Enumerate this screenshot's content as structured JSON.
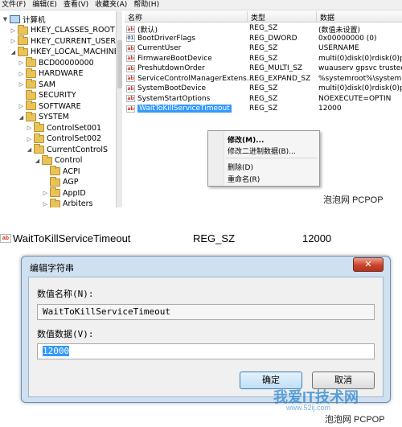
{
  "regedit": {
    "menu": [
      "文件(F)",
      "编辑(E)",
      "查看(V)",
      "收藏夹(A)",
      "帮助(H)"
    ],
    "tree": [
      {
        "label": "计算机",
        "indent": 0,
        "icon": "computer-icon",
        "toggle": "▼"
      },
      {
        "label": "HKEY_CLASSES_ROOT",
        "indent": 1,
        "icon": "folder-icon",
        "toggle": "▷"
      },
      {
        "label": "HKEY_CURRENT_USER",
        "indent": 1,
        "icon": "folder-icon",
        "toggle": "▷"
      },
      {
        "label": "HKEY_LOCAL_MACHINE",
        "indent": 1,
        "icon": "folder-icon",
        "toggle": "◢"
      },
      {
        "label": "BCD00000000",
        "indent": 2,
        "icon": "folder-icon",
        "toggle": "▷"
      },
      {
        "label": "HARDWARE",
        "indent": 2,
        "icon": "folder-icon",
        "toggle": "▷"
      },
      {
        "label": "SAM",
        "indent": 2,
        "icon": "folder-icon",
        "toggle": "▷"
      },
      {
        "label": "SECURITY",
        "indent": 2,
        "icon": "folder-icon",
        "toggle": ""
      },
      {
        "label": "SOFTWARE",
        "indent": 2,
        "icon": "folder-icon",
        "toggle": "▷"
      },
      {
        "label": "SYSTEM",
        "indent": 2,
        "icon": "folder-icon",
        "toggle": "◢"
      },
      {
        "label": "ControlSet001",
        "indent": 3,
        "icon": "folder-icon",
        "toggle": "▷"
      },
      {
        "label": "ControlSet002",
        "indent": 3,
        "icon": "folder-icon",
        "toggle": "▷"
      },
      {
        "label": "CurrentControlS",
        "indent": 3,
        "icon": "folder-icon",
        "toggle": "◢"
      },
      {
        "label": "Control",
        "indent": 4,
        "icon": "folder-icon",
        "toggle": "◢"
      },
      {
        "label": "ACPI",
        "indent": 5,
        "icon": "folder-icon",
        "toggle": ""
      },
      {
        "label": "AGP",
        "indent": 5,
        "icon": "folder-icon",
        "toggle": ""
      },
      {
        "label": "AppID",
        "indent": 5,
        "icon": "folder-icon",
        "toggle": "▷"
      },
      {
        "label": "Arbiters",
        "indent": 5,
        "icon": "folder-icon",
        "toggle": "▷"
      }
    ],
    "columns": {
      "name": "名称",
      "type": "类型",
      "data": "数据"
    },
    "rows": [
      {
        "name": "(默认)",
        "type": "REG_SZ",
        "data": "(数值未设置)",
        "icon": "string-value-icon",
        "icon_text": "ab"
      },
      {
        "name": "BootDriverFlags",
        "type": "REG_DWORD",
        "data": "0x00000000 (0)",
        "icon": "binary-value-icon",
        "icon_text": "01"
      },
      {
        "name": "CurrentUser",
        "type": "REG_SZ",
        "data": "USERNAME",
        "icon": "string-value-icon",
        "icon_text": "ab"
      },
      {
        "name": "FirmwareBootDevice",
        "type": "REG_SZ",
        "data": "multi(0)disk(0)rdisk(0)part",
        "icon": "string-value-icon",
        "icon_text": "ab"
      },
      {
        "name": "PreshutdownOrder",
        "type": "REG_MULTI_SZ",
        "data": "wuauserv gpsvc trustedins",
        "icon": "string-value-icon",
        "icon_text": "ab"
      },
      {
        "name": "ServiceControlManagerExtens...",
        "type": "REG_EXPAND_SZ",
        "data": "%systemroot%\\system32\\",
        "icon": "string-value-icon",
        "icon_text": "ab"
      },
      {
        "name": "SystemBootDevice",
        "type": "REG_SZ",
        "data": "multi(0)disk(0)rdisk(0)part",
        "icon": "string-value-icon",
        "icon_text": "ab"
      },
      {
        "name": "SystemStartOptions",
        "type": "REG_SZ",
        "data": "NOEXECUTE=OPTIN",
        "icon": "string-value-icon",
        "icon_text": "ab"
      },
      {
        "name": "WaitToKillServiceTimeout",
        "type": "REG_SZ",
        "data": "12000",
        "icon": "string-value-icon",
        "icon_text": "ab",
        "selected": true
      }
    ],
    "context_menu": [
      "修改(M)...",
      "修改二进制数据(B)...",
      "删除(D)",
      "重命名(R)"
    ],
    "watermark": "泡泡网 PCPOP"
  },
  "edit": {
    "entry": {
      "name": "WaitToKillServiceTimeout",
      "type": "REG_SZ",
      "value": "12000",
      "icon_text": "ab"
    },
    "dialog_title": "编辑字符串",
    "close_glyph": "✕",
    "name_label": "数值名称(N):",
    "name_value": "WaitToKillServiceTimeout",
    "data_label": "数值数据(V):",
    "data_value": "12000",
    "ok_label": "确定",
    "cancel_label": "取消",
    "watermark": "泡泡网 PCPOP",
    "site_watermark": "我爱IT技术网",
    "site_url": "www.52ij.com"
  }
}
